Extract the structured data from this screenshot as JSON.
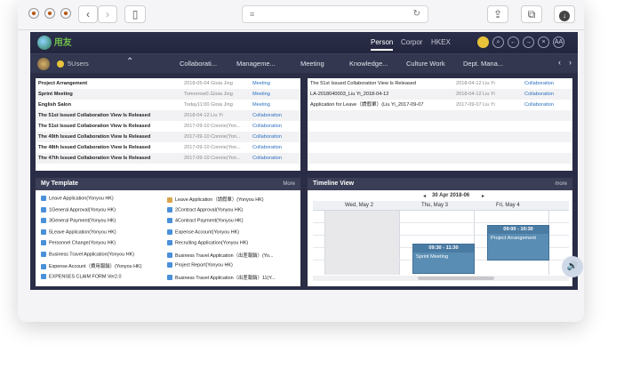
{
  "browser": {
    "back_icon": "chevron-left-icon",
    "forward_icon": "chevron-right-icon",
    "sidebar_icon": "sidebar-icon",
    "share_icon": "share-icon",
    "tabs_icon": "tabs-icon",
    "download_icon": "download-icon"
  },
  "header": {
    "logo_text": "用友",
    "tabs": [
      {
        "label": "Person",
        "active": true
      },
      {
        "label": "Corpor",
        "active": false
      },
      {
        "label": "HKEX",
        "active": false
      }
    ],
    "icons": [
      "ring-icon",
      "search-icon",
      "back-icon",
      "forward-icon",
      "close-icon",
      "AA"
    ]
  },
  "nav": {
    "user_count": "5Users",
    "items": [
      "Collaborati...",
      "Manageme...",
      "Meeting",
      "Knowledge...",
      "Culture Work",
      "Dept. Mana..."
    ]
  },
  "left_list": {
    "rows": [
      {
        "title": "Project Arrangement",
        "date": "2018-05-04",
        "person": "Gioia Jing",
        "type": "Meeting"
      },
      {
        "title": "Sprint Meeting",
        "date": "Tomorrow0...",
        "person": "Gioia Jing",
        "type": "Meeting"
      },
      {
        "title": "English Salon",
        "date": "Today11:00",
        "person": "Gioia Jing",
        "type": "Meeting"
      },
      {
        "title": "The 51st Issued Collaboration View Is Released",
        "date": "2018-04-12",
        "person": "Liu Yi",
        "type": "Collaboration"
      },
      {
        "title": "The 51st Issued Collaboration View Is Released",
        "date": "2017-09-10",
        "person": "Connie(Yon...",
        "type": "Collaboration"
      },
      {
        "title": "The 49th Issued Collaboration View Is Released",
        "date": "2017-09-10",
        "person": "Connie(Yon...",
        "type": "Collaboration"
      },
      {
        "title": "The 48th Issued Collaboration View Is Released",
        "date": "2017-09-10",
        "person": "Connie(Yon...",
        "type": "Collaboration"
      },
      {
        "title": "The 47th Issued Collaboration View Is Released",
        "date": "2017-09-10",
        "person": "Connie(Yon...",
        "type": "Collaboration"
      }
    ]
  },
  "right_list": {
    "rows": [
      {
        "title": "The 51st Issued Collaboration View Is Released",
        "date": "2018-04-12",
        "person": "Liu Yi",
        "type": "Collaboration"
      },
      {
        "title": "LA-2018040003_Liu Yi_2018-04-12",
        "date": "2018-04-12",
        "person": "Liu Yi",
        "type": "Collaboration"
      },
      {
        "title": "Application for Leave（請假單）(Liu Yi_2017-09-07",
        "date": "2017-09-07",
        "person": "Liu Yi",
        "type": "Collaboration"
      }
    ]
  },
  "my_template": {
    "title": "My Template",
    "more": "More",
    "left": [
      "Leave Application(Yonyou HK)",
      "1General Approval(Yonyou HK)",
      "3General Payment(Yonyou HK)",
      "5Leave Application(Yonyou HK)",
      "Personnel Change(Yonyou HK)",
      "Business Travel Application(Yonyou HK)",
      "Expense Account（費用報銷）(Yonyou HK)",
      "EXPENSES CLAIM FORM Ver2.0"
    ],
    "right": [
      "Leave Application（請假單）(Yonyou HK)",
      "2Contract Approval(Yonyou HK)",
      "4Contract Payment(Yonyou HK)",
      "Expense Account(Yonyou HK)",
      "Recruiting Application(Yonyou HK)",
      "Business Travel Application（出差報銷）(Yo...",
      "Project Report(Yonyou HK)",
      "Business Travel Application（出差報銷）11(Y..."
    ]
  },
  "timeline": {
    "title": "Timeline View",
    "more": "more",
    "range": "30 Apr 2018-06",
    "days": [
      "Wed, May 2",
      "Thu, May 3",
      "Fri, May 4"
    ],
    "events": [
      {
        "time": "09:30 - 11:30",
        "title": "Sprint Meeting"
      },
      {
        "time": "09:00 - 10:30",
        "title": "Project Arrangement"
      }
    ]
  }
}
